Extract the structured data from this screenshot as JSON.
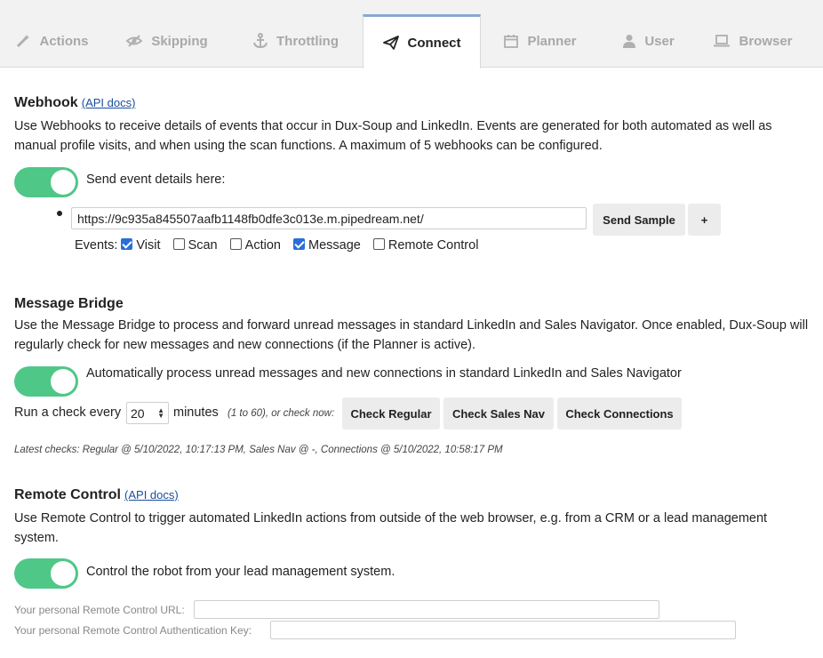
{
  "tabs": [
    {
      "label": "Actions",
      "icon": "magic-wand-icon"
    },
    {
      "label": "Skipping",
      "icon": "eye-slash-icon"
    },
    {
      "label": "Throttling",
      "icon": "anchor-icon"
    },
    {
      "label": "Connect",
      "icon": "paper-plane-icon",
      "active": true
    },
    {
      "label": "Planner",
      "icon": "calendar-icon"
    },
    {
      "label": "User",
      "icon": "user-icon"
    },
    {
      "label": "Browser",
      "icon": "laptop-icon"
    }
  ],
  "webhook": {
    "title": "Webhook",
    "api_link": "(API docs)",
    "description": "Use Webhooks to receive details of events that occur in Dux-Soup and LinkedIn. Events are generated for both automated as well as manual profile visits, and when using the scan functions. A maximum of 5 webhooks can be configured.",
    "toggle_on": true,
    "toggle_label": "Send event details here:",
    "url": "https://9c935a845507aafb1148fb0dfe3c013e.m.pipedream.net/",
    "send_sample": "Send Sample",
    "add": "+",
    "events_label": "Events:",
    "events": [
      {
        "label": "Visit",
        "checked": true
      },
      {
        "label": "Scan",
        "checked": false
      },
      {
        "label": "Action",
        "checked": false
      },
      {
        "label": "Message",
        "checked": true
      },
      {
        "label": "Remote Control",
        "checked": false
      }
    ]
  },
  "bridge": {
    "title": "Message Bridge",
    "description": "Use the Message Bridge to process and forward unread messages in standard LinkedIn and Sales Navigator. Once enabled, Dux-Soup will regularly check for new messages and new connections (if the Planner is active).",
    "toggle_on": true,
    "toggle_label": "Automatically process unread messages and new connections in standard LinkedIn and Sales Navigator",
    "run_prefix": "Run a check every",
    "interval": "20",
    "run_suffix": "minutes",
    "range_note": "(1 to 60), or check now:",
    "check_regular": "Check Regular",
    "check_sales_nav": "Check Sales Nav",
    "check_connections": "Check Connections",
    "latest": "Latest checks: Regular @ 5/10/2022, 10:17:13 PM, Sales Nav @ -, Connections @ 5/10/2022, 10:58:17 PM"
  },
  "remote": {
    "title": "Remote Control",
    "api_link": "(API docs)",
    "description": "Use Remote Control to trigger automated LinkedIn actions from outside of the web browser, e.g. from a CRM or a lead management system.",
    "toggle_on": true,
    "toggle_label": "Control the robot from your lead management system.",
    "url_label": "Your personal Remote Control URL:",
    "url_value": "",
    "key_label": "Your personal Remote Control Authentication Key:",
    "key_value": ""
  },
  "colors": {
    "toggle": "#4fc787",
    "link": "#1a4f9c",
    "active_tab_border": "#8aa8d4",
    "checkbox": "#2a6ed8"
  }
}
